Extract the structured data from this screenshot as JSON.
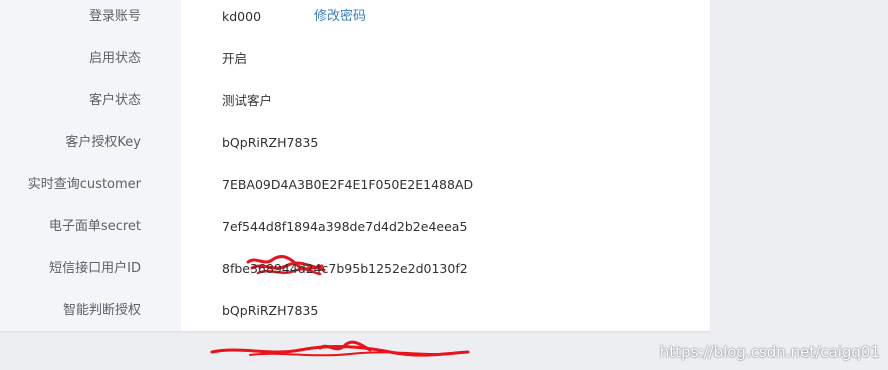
{
  "fields": [
    {
      "key": "login_account",
      "label": "登录账号",
      "value": "kd000",
      "action": "修改密码"
    },
    {
      "key": "enable_status",
      "label": "启用状态",
      "value": "开启"
    },
    {
      "key": "customer_status",
      "label": "客户状态",
      "value": "测试客户"
    },
    {
      "key": "customer_auth_key",
      "label": "客户授权Key",
      "value": "bQpRiRZH7835"
    },
    {
      "key": "realtime_query_customer",
      "label": "实时查询customer",
      "value": "7EBA09D4A3B0E2F4E1F050E2E1488AD"
    },
    {
      "key": "eorder_secret",
      "label": "电子面单secret",
      "value": "7ef544d8f1894a398de7d4d2b2e4eea5"
    },
    {
      "key": "sms_user_id",
      "label": "短信接口用户ID",
      "value": "8fbe368944d24c7b95b1252e2d0130f2"
    },
    {
      "key": "smart_judge_auth",
      "label": "智能判断授权",
      "value": "bQpRiRZH7835"
    }
  ],
  "watermark": "https://blog.csdn.net/caigq01",
  "colors": {
    "page_bg": "#eceef2",
    "panel_bg": "#ffffff",
    "label_col_bg": "#f4f5f8",
    "link": "#3a7fc1",
    "redaction": "#e8141b"
  }
}
